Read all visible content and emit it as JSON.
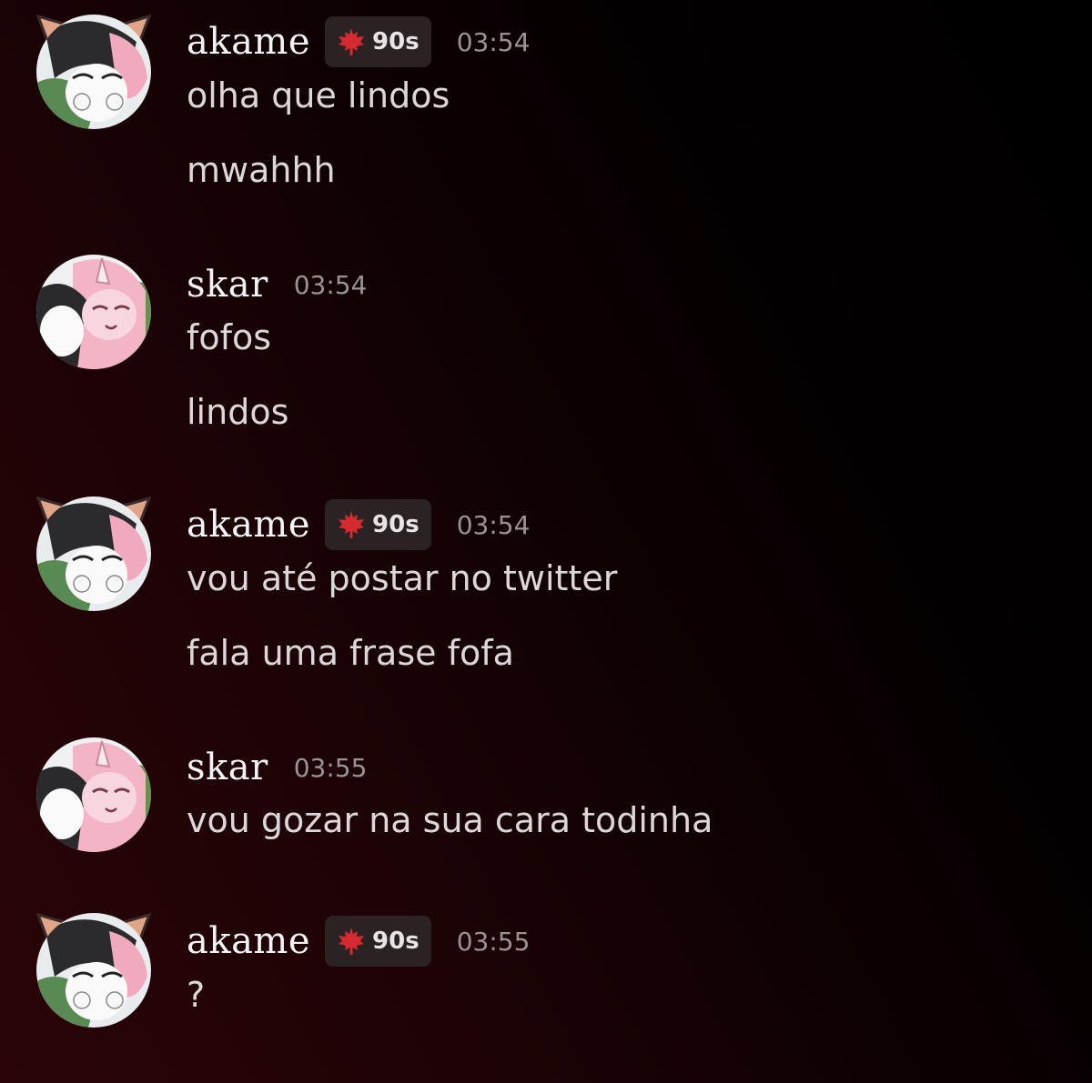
{
  "colors": {
    "background_left": "#2a0407",
    "background_right": "#000000",
    "username": "#f2f3f5",
    "message_text": "#dcd7d8",
    "timestamp": "#9b9294",
    "tag_background": "#2b2224",
    "tag_icon": "#d42a30"
  },
  "messages": [
    {
      "author": "akame",
      "avatar_icon": "avatar-akame-icon",
      "tag": {
        "icon": "maple-leaf-icon",
        "text": "90s"
      },
      "timestamp": "03:54",
      "lines": [
        "olha que lindos",
        "mwahhh"
      ]
    },
    {
      "author": "skar",
      "avatar_icon": "avatar-skar-icon",
      "timestamp": "03:54",
      "lines": [
        "fofos",
        "lindos"
      ]
    },
    {
      "author": "akame",
      "avatar_icon": "avatar-akame-icon",
      "tag": {
        "icon": "maple-leaf-icon",
        "text": "90s"
      },
      "timestamp": "03:54",
      "lines": [
        "vou até postar no twitter",
        "fala uma frase fofa"
      ]
    },
    {
      "author": "skar",
      "avatar_icon": "avatar-skar-icon",
      "timestamp": "03:55",
      "lines": [
        "vou gozar na sua cara todinha"
      ]
    },
    {
      "author": "akame",
      "avatar_icon": "avatar-akame-icon",
      "tag": {
        "icon": "maple-leaf-icon",
        "text": "90s"
      },
      "timestamp": "03:55",
      "lines": [
        "?"
      ]
    }
  ]
}
